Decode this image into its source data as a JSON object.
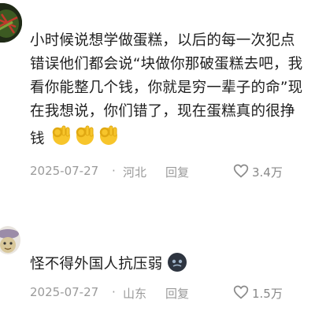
{
  "comments": [
    {
      "text_lines": [
        "小时候说想学做蛋糕，以后的每一次犯点",
        "错误他们都会说“块做你那破蛋糕去吧，我",
        "看你能整几个钱，你就是穷一辈子的命”现",
        "在我想说，你们错了，现在蛋糕真的很挣",
        "钱"
      ],
      "emojis": [
        "ok-hand-emoji",
        "ok-hand-emoji",
        "ok-hand-emoji"
      ],
      "date": "2025-07-27",
      "separator": "·",
      "location": "河北",
      "reply_label": "回复",
      "like_count": "3.4万",
      "avatar_icon": "food-dish-avatar"
    },
    {
      "text_lines": [
        "怪不得外国人抗压弱"
      ],
      "emojis": [
        "dark-round-face-emoji"
      ],
      "date": "2025-07-27",
      "separator": "·",
      "location": "山东",
      "reply_label": "回复",
      "like_count": "1.5万",
      "avatar_icon": "cartoon-creature-avatar"
    }
  ],
  "colors": {
    "text": "#1f1f1f",
    "meta": "#9a9a9a",
    "emoji_yellow": "#f7c52b",
    "emoji_dark": "#2e3540"
  }
}
